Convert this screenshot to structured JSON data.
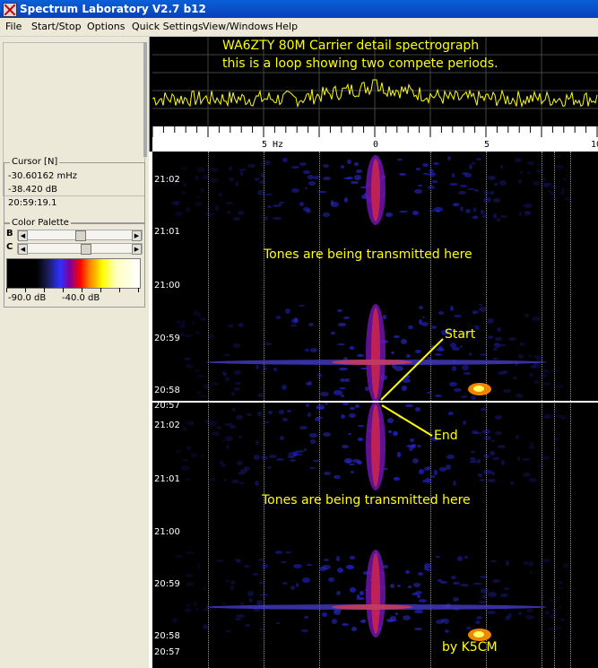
{
  "window": {
    "title": "Spectrum Laboratory V2.7 b12"
  },
  "menu": [
    "File",
    "Start/Stop",
    "Options",
    "Quick Settings",
    "View/Windows",
    "Help"
  ],
  "cursor_panel": {
    "title": "Cursor [N]",
    "frequency": "-30.60162 mHz",
    "level": "-38.420 dB",
    "time": "20:59:19.1"
  },
  "palette_panel": {
    "title": "Color Palette",
    "b_label": "B",
    "c_label": "C",
    "b_value": 0.5,
    "c_value": 0.55,
    "min_label": "-90.0 dB",
    "max_label": "-40.0 dB"
  },
  "spectrum": {
    "annotation_line1": "WA6ZTY 80M Carrier detail spectrograph",
    "annotation_line2": "this is a loop showing two compete periods.",
    "trace_color": "#ffff00"
  },
  "freq_axis": {
    "labels": [
      "5 Hz",
      "0",
      "5",
      "10"
    ]
  },
  "waterfall": {
    "time_labels": [
      "21:02",
      "21:01",
      "21:00",
      "20:59",
      "20:58",
      "20:57",
      "21:02",
      "21:01",
      "21:00",
      "20:59",
      "20:58",
      "20:57"
    ],
    "tones_text_1": "Tones are being transmitted here",
    "tones_text_2": "Tones are being transmitted here",
    "start_label": "Start",
    "end_label": "End",
    "credit": "by K5CM"
  },
  "colors": {
    "annotation": "#ffff00",
    "titlebar": "#0a5fd8"
  }
}
